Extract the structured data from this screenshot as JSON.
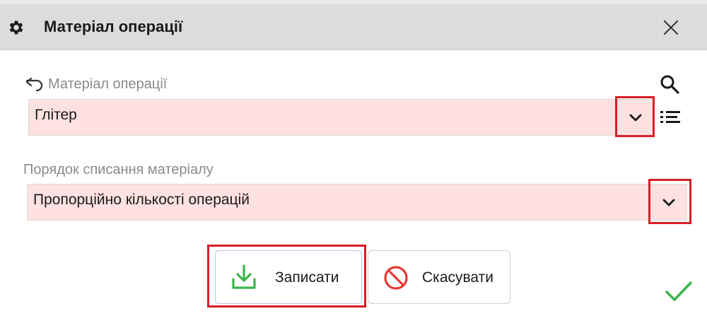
{
  "dialog": {
    "title": "Матеріал операції"
  },
  "fields": {
    "material": {
      "label": "Матеріал операції",
      "value": "Глітер"
    },
    "order": {
      "label": "Порядок списання матеріалу",
      "value": "Пропорційно кількості операцій"
    }
  },
  "buttons": {
    "save": "Записати",
    "cancel": "Скасувати"
  },
  "colors": {
    "field_bg": "#ffe1e1",
    "highlight": "#d81e28",
    "save_icon": "#3bb54a",
    "cancel_icon": "#e53935",
    "confirm": "#3bb54a"
  }
}
